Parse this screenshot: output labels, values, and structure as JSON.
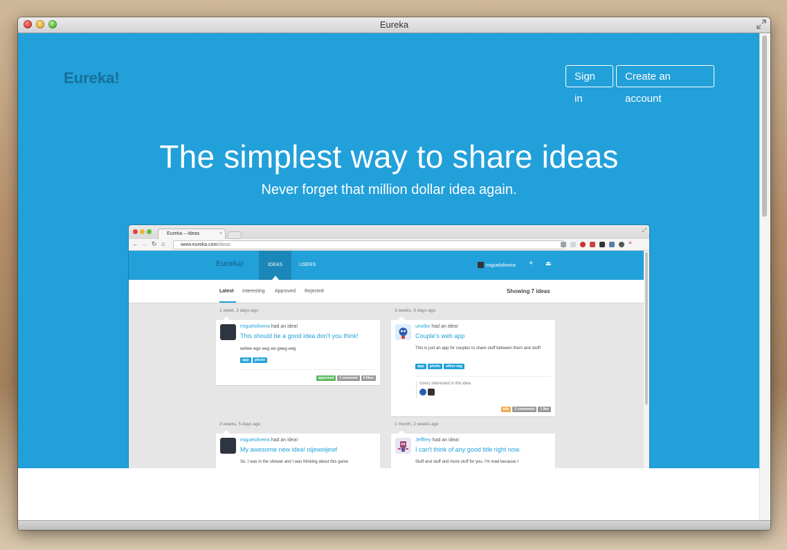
{
  "window": {
    "title": "Eureka"
  },
  "site": {
    "brand": "Eureka!",
    "sign_in": "Sign in",
    "create_account": "Create an account",
    "headline": "The simplest way to share ideas",
    "subheadline": "Never forget that million dollar idea again."
  },
  "screenshot": {
    "tab_title": "Eureka – Ideas",
    "url_host": "www.eureka.com",
    "url_path": "/ideas",
    "nav": {
      "brand": "Eureka!",
      "ideas": "IDEAS",
      "users": "USERS",
      "user": "migueloliveira"
    },
    "subnav": [
      "Latest",
      "Interesting",
      "Approved",
      "Rejected"
    ],
    "showing": "Showing 7 ideas",
    "ideas": [
      {
        "date": "1 week, 2 days ago",
        "user": "migueloliveira",
        "had": "had an idea!",
        "title": "This should be a good idea don't you think!",
        "body": "wefwe wge weg we gweg weg",
        "tags": [
          "app",
          "photo"
        ],
        "status": "approved",
        "comments": "1 comment",
        "likes": "0 likes"
      },
      {
        "date": "3 weeks, 5 days ago",
        "user": "unutbu",
        "had": "had an idea!",
        "title": "Couple's web app",
        "body": "This is just an app for couples to share stuff between them and stuff!",
        "tags": [
          "app",
          "photo",
          "other-tag"
        ],
        "interested_label": "Users interested in this idea",
        "status": "idle",
        "comments": "2 comments",
        "likes": "1 like"
      },
      {
        "date": "3 weeks, 5 days ago",
        "user": "migueloliveira",
        "had": "had an idea!",
        "title": "My awesome new idea! oijewoijewf",
        "body": "So. I was in the shower and I was thinking about this game"
      },
      {
        "date": "1 month, 2 weeks ago",
        "user": "Jefffrey",
        "had": "had an idea!",
        "title": "I can't think of any good title right now.",
        "body": "Stuff and stuff and more stuff for you. I'm mad because I"
      }
    ]
  },
  "colors": {
    "hero_blue": "#22a0da",
    "brand_dark": "#176f98",
    "nav_active": "#1b86b8",
    "approved": "#5cb85c",
    "idle": "#f0ad4e"
  }
}
